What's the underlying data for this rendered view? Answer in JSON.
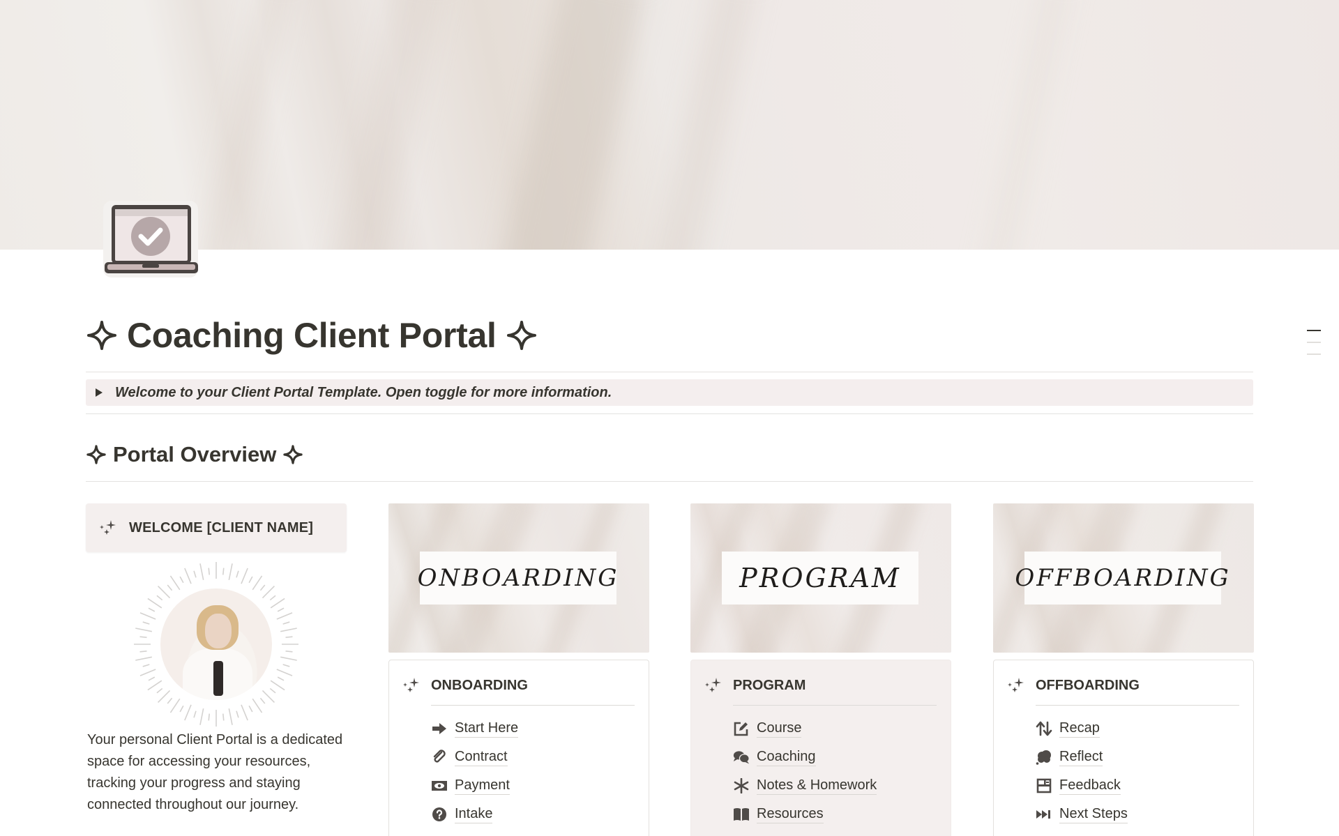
{
  "page": {
    "title": "Coaching Client Portal",
    "icon": "laptop-check-icon",
    "title_ornament": "sparkle-outline-icon"
  },
  "toggle": {
    "text": "Welcome to your Client Portal Template. Open toggle for more information.",
    "state": "collapsed"
  },
  "section": {
    "heading": "Portal Overview"
  },
  "welcome": {
    "label": "WELCOME [CLIENT NAME]",
    "intro": "Your personal Client Portal is a dedicated space for accessing your resources, tracking your progress and staying connected throughout our journey."
  },
  "columns": [
    {
      "banner": "ONBOARDING",
      "header": "ONBOARDING",
      "items": [
        {
          "label": "Start Here",
          "icon": "arrow-right-icon"
        },
        {
          "label": "Contract",
          "icon": "paperclip-icon"
        },
        {
          "label": "Payment",
          "icon": "money-bill-icon"
        },
        {
          "label": "Intake",
          "icon": "question-circle-icon"
        }
      ]
    },
    {
      "banner": "PROGRAM",
      "header": "PROGRAM",
      "items": [
        {
          "label": "Course",
          "icon": "edit-square-icon"
        },
        {
          "label": "Coaching",
          "icon": "chat-bubbles-icon"
        },
        {
          "label": "Notes & Homework",
          "icon": "asterisk-icon"
        },
        {
          "label": "Resources",
          "icon": "book-open-icon"
        }
      ]
    },
    {
      "banner": "OFFBOARDING",
      "header": "OFFBOARDING",
      "items": [
        {
          "label": "Recap",
          "icon": "arrows-up-down-icon"
        },
        {
          "label": "Reflect",
          "icon": "thought-bubble-icon"
        },
        {
          "label": "Feedback",
          "icon": "form-icon"
        },
        {
          "label": "Next Steps",
          "icon": "fast-forward-icon"
        }
      ]
    }
  ],
  "colors": {
    "text": "#37352f",
    "callout_bg": "#f4eeee",
    "card_bg": "#f4efee",
    "icon_gray": "#4f4b48",
    "laptop_screen": "#efe6e6",
    "laptop_check": "#b6a7a8"
  }
}
